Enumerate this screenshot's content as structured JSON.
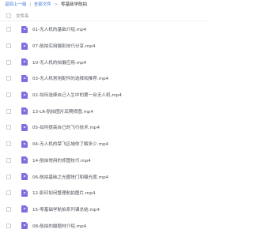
{
  "breadcrumb": {
    "back_label": "返回上一级",
    "sep1": "|",
    "root_label": "全部文件",
    "sep2": ">",
    "current_label": "零基础学航拍"
  },
  "list_header": {
    "column_label": "文件名"
  },
  "files": [
    {
      "name": "01-无人机的基础介绍.mp4",
      "icon": "video-file-icon"
    },
    {
      "name": "07-航拍实用摄影技巧分享.mp4",
      "icon": "video-file-icon"
    },
    {
      "name": "10-无人机的拍摄应用.mp4",
      "icon": "video-file-icon"
    },
    {
      "name": "03-无人机常用配件的选择和推荐.mp4",
      "icon": "video-file-icon"
    },
    {
      "name": "02-如何选择自己人生中的第一台无人机.mp4",
      "icon": "video-file-icon"
    },
    {
      "name": "13-LR-航拍图片后期修图.mp4",
      "icon": "video-file-icon"
    },
    {
      "name": "05-如何提高自己的飞行技术.mp4",
      "icon": "video-file-icon"
    },
    {
      "name": "04-无人机的禁飞区域你了解多少.mp4",
      "icon": "video-file-icon"
    },
    {
      "name": "14-航拍常用的修图技巧.mp4",
      "icon": "video-file-icon"
    },
    {
      "name": "06-航拍基础之光圈快门和曝光度.mp4",
      "icon": "video-file-icon"
    },
    {
      "name": "12-影印如何整理航拍图片.mp4",
      "icon": "video-file-icon"
    },
    {
      "name": "15-零基础学航拍系列课总结.mp4",
      "icon": "video-file-icon"
    },
    {
      "name": "08-航拍的摄题材介绍.mp4",
      "icon": "video-file-icon"
    }
  ],
  "colors": {
    "link": "#3a75d8",
    "video_icon": "#7e6fe0"
  }
}
